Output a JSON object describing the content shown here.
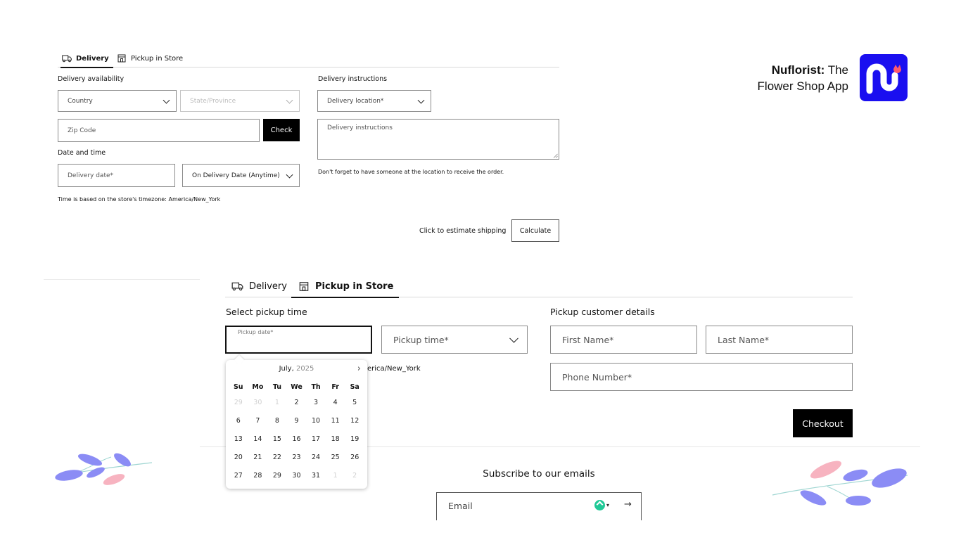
{
  "top_form": {
    "tabs": [
      {
        "label": "Delivery",
        "icon": "truck-icon",
        "active": true
      },
      {
        "label": "Pickup in Store",
        "icon": "store-icon",
        "active": false
      }
    ],
    "delivery_availability": {
      "label": "Delivery availability",
      "country_placeholder": "Country",
      "state_placeholder": "State/Province",
      "zip_placeholder": "Zip Code",
      "check_label": "Check"
    },
    "date_time": {
      "label": "Date and time",
      "date_placeholder": "Delivery date*",
      "time_option": "On Delivery Date (Anytime)",
      "timezone_note": "Time is based on the store's timezone: America/New_York"
    },
    "instructions": {
      "label": "Delivery instructions",
      "location_placeholder": "Delivery location*",
      "textarea_placeholder": "Delivery instructions",
      "note": "Don't forget to have someone at the location to receive the order."
    },
    "shipping": {
      "prompt": "Click to estimate shipping",
      "calculate_label": "Calculate"
    }
  },
  "brand": {
    "name": "Nuflorist:",
    "tagline_1": "The",
    "tagline_2": "Flower Shop App",
    "logo_accent": "#1a0ff0",
    "logo_petal": "#ff5a6e"
  },
  "pickup_form": {
    "tabs": [
      {
        "label": "Delivery",
        "icon": "truck-icon",
        "active": false
      },
      {
        "label": "Pickup in Store",
        "icon": "store-icon",
        "active": true
      }
    ],
    "select_time_label": "Select pickup time",
    "date_float_label": "Pickup date*",
    "time_placeholder": "Pickup time*",
    "timezone_partial": "erica/New_York",
    "customer_label": "Pickup customer details",
    "first_name_placeholder": "First Name*",
    "last_name_placeholder": "Last Name*",
    "phone_placeholder": "Phone Number*",
    "checkout_label": "Checkout"
  },
  "calendar": {
    "month": "July,",
    "year": "2025",
    "weekdays": [
      "Su",
      "Mo",
      "Tu",
      "We",
      "Th",
      "Fr",
      "Sa"
    ],
    "days": [
      {
        "d": "29",
        "muted": true
      },
      {
        "d": "30",
        "muted": true
      },
      {
        "d": "1",
        "muted": true
      },
      {
        "d": "2",
        "muted": false
      },
      {
        "d": "3",
        "muted": false
      },
      {
        "d": "4",
        "muted": false
      },
      {
        "d": "5",
        "muted": false
      },
      {
        "d": "6",
        "muted": false
      },
      {
        "d": "7",
        "muted": false
      },
      {
        "d": "8",
        "muted": false
      },
      {
        "d": "9",
        "muted": false
      },
      {
        "d": "10",
        "muted": false
      },
      {
        "d": "11",
        "muted": false
      },
      {
        "d": "12",
        "muted": false
      },
      {
        "d": "13",
        "muted": false
      },
      {
        "d": "14",
        "muted": false
      },
      {
        "d": "15",
        "muted": false
      },
      {
        "d": "16",
        "muted": false
      },
      {
        "d": "17",
        "muted": false
      },
      {
        "d": "18",
        "muted": false
      },
      {
        "d": "19",
        "muted": false
      },
      {
        "d": "20",
        "muted": false
      },
      {
        "d": "21",
        "muted": false
      },
      {
        "d": "22",
        "muted": false
      },
      {
        "d": "23",
        "muted": false
      },
      {
        "d": "24",
        "muted": false
      },
      {
        "d": "25",
        "muted": false
      },
      {
        "d": "26",
        "muted": false
      },
      {
        "d": "27",
        "muted": false
      },
      {
        "d": "28",
        "muted": false
      },
      {
        "d": "29",
        "muted": false
      },
      {
        "d": "30",
        "muted": false
      },
      {
        "d": "31",
        "muted": false
      },
      {
        "d": "1",
        "muted": true
      },
      {
        "d": "2",
        "muted": true
      }
    ]
  },
  "footer": {
    "subscribe_title": "Subscribe to our emails",
    "email_placeholder": "Email"
  },
  "colors": {
    "leaf_purple": "#8b8cf5",
    "leaf_pink": "#f7b3c0",
    "stem": "#9fd6d2"
  }
}
